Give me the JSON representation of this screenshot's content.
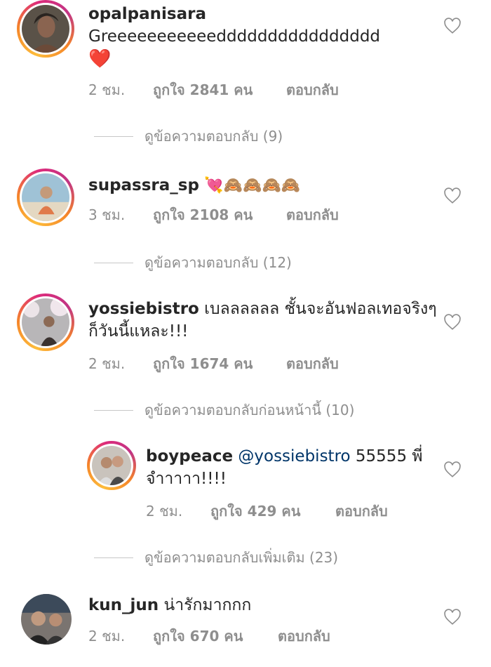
{
  "comments": [
    {
      "username": "opalpanisara",
      "text": "Greeeeeeeeeeedddddddddddddddd",
      "emoji": "❤️",
      "time": "2 ชม.",
      "likes": "ถูกใจ 2841 คน",
      "reply": "ตอบกลับ",
      "view_replies": "ดูข้อความตอบกลับ (9)"
    },
    {
      "username": "supassra_sp",
      "text": "",
      "emoji": "💘🙈🙈🙈🙈",
      "time": "3 ชม.",
      "likes": "ถูกใจ 2108 คน",
      "reply": "ตอบกลับ",
      "view_replies": "ดูข้อความตอบกลับ (12)"
    },
    {
      "username": "yossiebistro",
      "text": "เบลลลลลล ชั้นจะอันฟอลเทอจริงๆก็วันนี้แหละ!!!",
      "time": "2 ชม.",
      "likes": "ถูกใจ 1674 คน",
      "reply": "ตอบกลับ",
      "view_replies": "ดูข้อความตอบกลับก่อนหน้านี้ (10)"
    },
    {
      "username": "boypeace",
      "mention": "@yossiebistro",
      "text": "55555 พี่จำาาาา!!!!",
      "time": "2 ชม.",
      "likes": "ถูกใจ 429 คน",
      "reply": "ตอบกลับ",
      "view_replies": "ดูข้อความตอบกลับเพิ่มเติม (23)"
    },
    {
      "username": "kun_jun",
      "text": "น่ารักมากกก",
      "time": "2 ชม.",
      "likes": "ถูกใจ 670 คน",
      "reply": "ตอบกลับ"
    }
  ],
  "icons": {
    "like": "heart-outline-icon"
  },
  "colors": {
    "ring_start": "#fdbc3b",
    "ring_mid": "#dd2a7b",
    "mention": "#003569",
    "secondary_text": "#8e8e8e"
  }
}
